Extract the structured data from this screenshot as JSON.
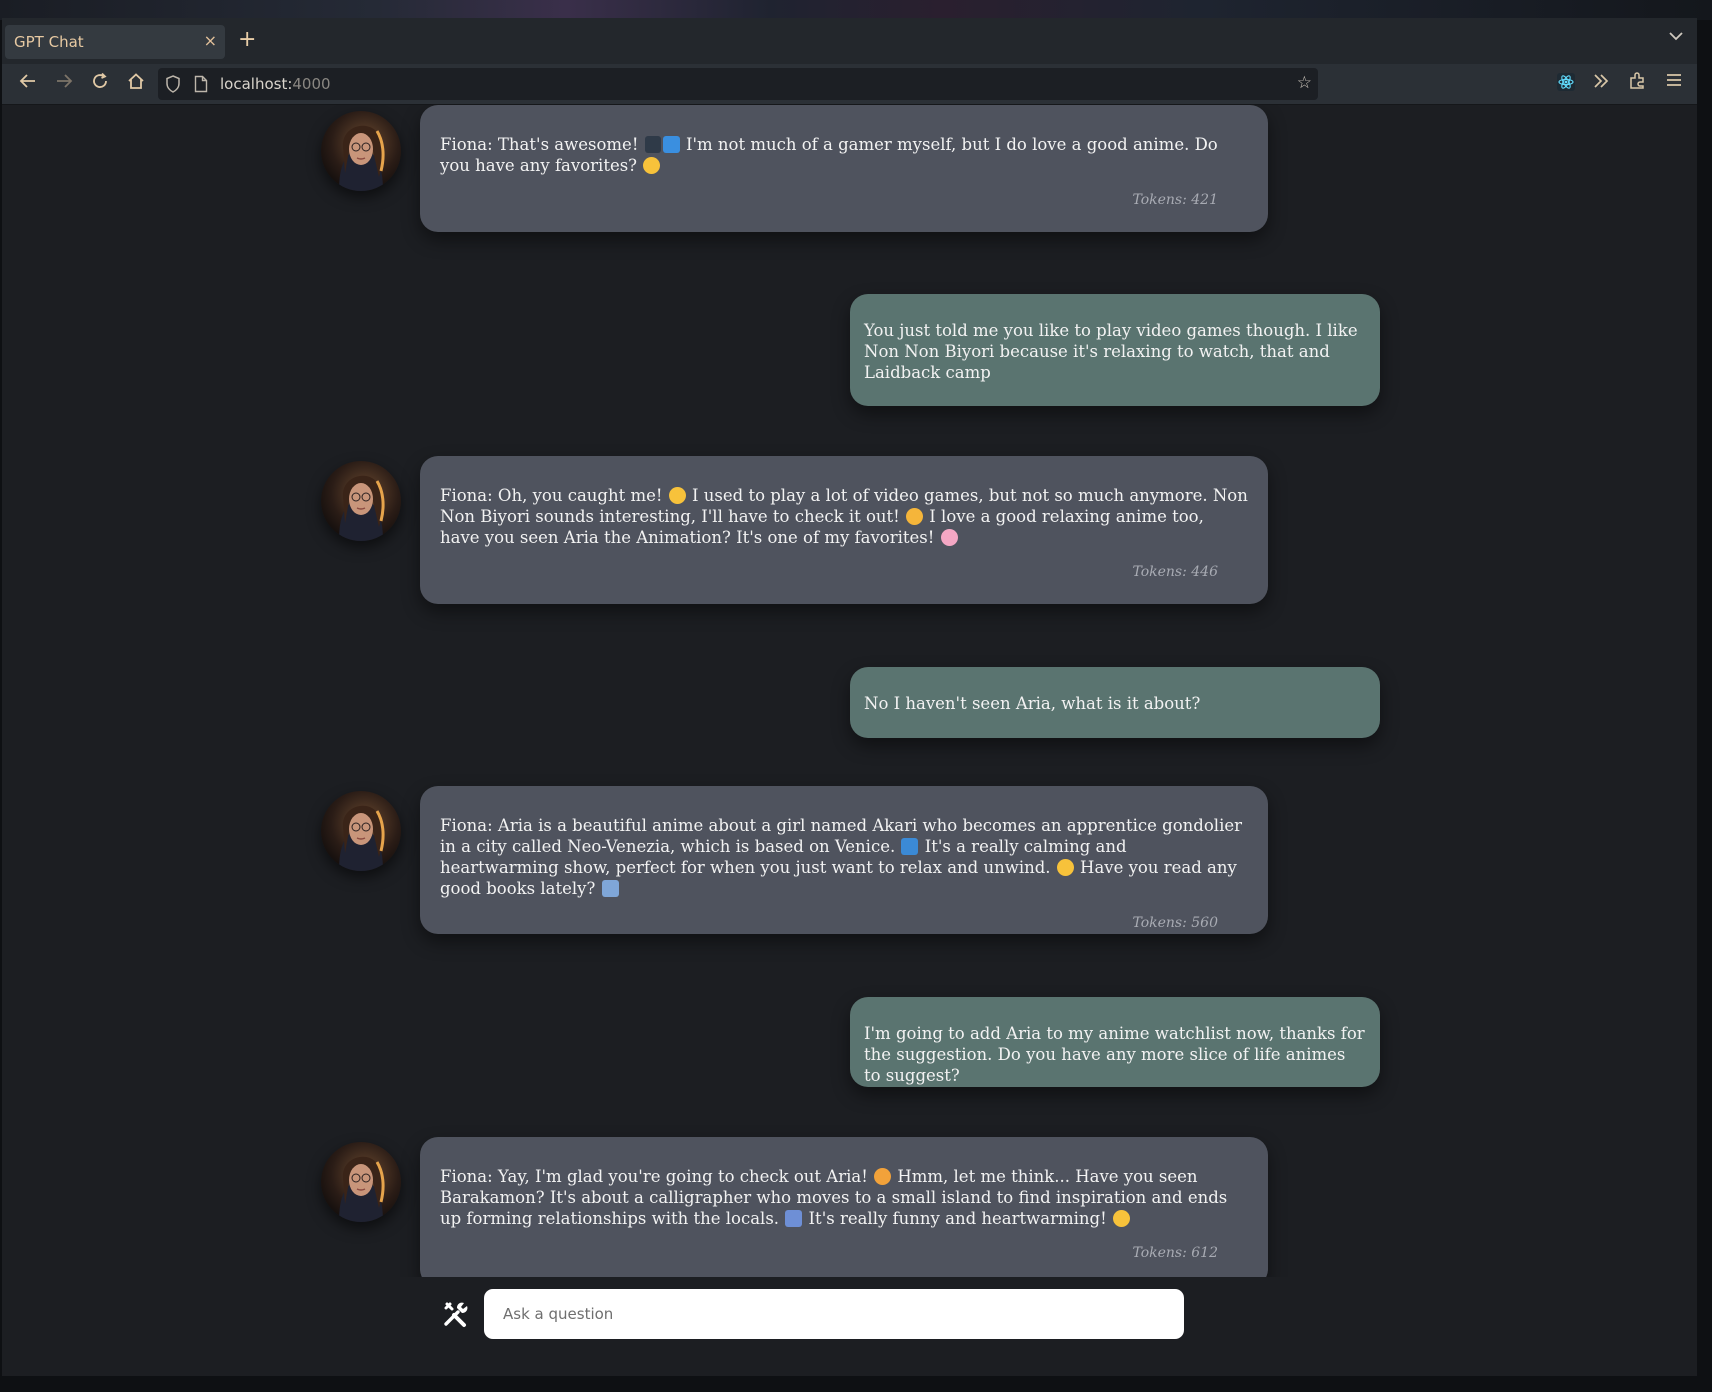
{
  "browser": {
    "tab_title": "GPT Chat",
    "tab_close": "×",
    "new_tab": "+",
    "url_host": "localhost:",
    "url_port": "4000"
  },
  "chat": {
    "messages": [
      {
        "role": "bot",
        "avatar_icon": "fiona-avatar-icon",
        "text_before_emoji": "Fiona: That's awesome! ",
        "text_after_emoji": " I'm not much of a gamer myself, but I do love a good anime. Do you have any favorites? ",
        "tokens": "Tokens: 421"
      },
      {
        "role": "user",
        "text": "You just told me you like to play video games though. I like Non Non Biyori because it's relaxing to watch, that and Laidback camp"
      },
      {
        "role": "bot",
        "avatar_icon": "fiona-avatar-icon",
        "text_a": "Fiona: Oh, you caught me! ",
        "text_b": " I used to play a lot of video games, but not so much anymore. Non Non Biyori sounds interesting, I'll have to check it out! ",
        "text_c": " I love a good relaxing anime too, have you seen Aria the Animation? It's one of my favorites! ",
        "tokens": "Tokens: 446"
      },
      {
        "role": "user",
        "text": "No I haven't seen Aria, what is it about?"
      },
      {
        "role": "bot",
        "avatar_icon": "fiona-avatar-icon",
        "text_a": "Fiona: Aria is a beautiful anime about a girl named Akari who becomes an apprentice gondolier in a city called Neo-Venezia, which is based on Venice. ",
        "text_b": " It's a really calming and heartwarming show, perfect for when you just want to relax and unwind. ",
        "text_c": " Have you read any good books lately? ",
        "tokens": "Tokens: 560"
      },
      {
        "role": "user",
        "text": "I'm going to add Aria to my anime watchlist now, thanks for the suggestion. Do you have any more slice of life animes to suggest?"
      },
      {
        "role": "bot",
        "avatar_icon": "fiona-avatar-icon",
        "text_a": "Fiona: Yay, I'm glad you're going to check out Aria! ",
        "text_b": " Hmm, let me think... Have you seen Barakamon? It's about a calligrapher who moves to a small island to find inspiration and ends up forming relationships with the locals. ",
        "text_c": " It's really funny and heartwarming! ",
        "tokens": "Tokens: 612"
      }
    ]
  },
  "input": {
    "placeholder": "Ask a question",
    "tools_icon": "tools-icon"
  },
  "colors": {
    "bot_bubble": "#4f535e",
    "user_bubble": "#5a7470",
    "page_bg": "#1c1e22"
  }
}
